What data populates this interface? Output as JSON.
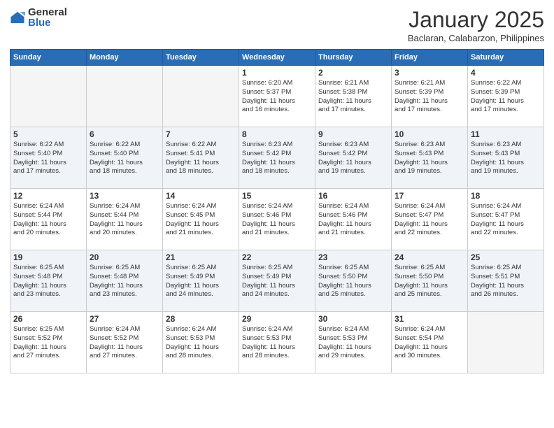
{
  "logo": {
    "general": "General",
    "blue": "Blue"
  },
  "title": "January 2025",
  "location": "Baclaran, Calabarzon, Philippines",
  "days_header": [
    "Sunday",
    "Monday",
    "Tuesday",
    "Wednesday",
    "Thursday",
    "Friday",
    "Saturday"
  ],
  "weeks": [
    [
      {
        "day": "",
        "info": ""
      },
      {
        "day": "",
        "info": ""
      },
      {
        "day": "",
        "info": ""
      },
      {
        "day": "1",
        "info": "Sunrise: 6:20 AM\nSunset: 5:37 PM\nDaylight: 11 hours\nand 16 minutes."
      },
      {
        "day": "2",
        "info": "Sunrise: 6:21 AM\nSunset: 5:38 PM\nDaylight: 11 hours\nand 17 minutes."
      },
      {
        "day": "3",
        "info": "Sunrise: 6:21 AM\nSunset: 5:39 PM\nDaylight: 11 hours\nand 17 minutes."
      },
      {
        "day": "4",
        "info": "Sunrise: 6:22 AM\nSunset: 5:39 PM\nDaylight: 11 hours\nand 17 minutes."
      }
    ],
    [
      {
        "day": "5",
        "info": "Sunrise: 6:22 AM\nSunset: 5:40 PM\nDaylight: 11 hours\nand 17 minutes."
      },
      {
        "day": "6",
        "info": "Sunrise: 6:22 AM\nSunset: 5:40 PM\nDaylight: 11 hours\nand 18 minutes."
      },
      {
        "day": "7",
        "info": "Sunrise: 6:22 AM\nSunset: 5:41 PM\nDaylight: 11 hours\nand 18 minutes."
      },
      {
        "day": "8",
        "info": "Sunrise: 6:23 AM\nSunset: 5:42 PM\nDaylight: 11 hours\nand 18 minutes."
      },
      {
        "day": "9",
        "info": "Sunrise: 6:23 AM\nSunset: 5:42 PM\nDaylight: 11 hours\nand 19 minutes."
      },
      {
        "day": "10",
        "info": "Sunrise: 6:23 AM\nSunset: 5:43 PM\nDaylight: 11 hours\nand 19 minutes."
      },
      {
        "day": "11",
        "info": "Sunrise: 6:23 AM\nSunset: 5:43 PM\nDaylight: 11 hours\nand 19 minutes."
      }
    ],
    [
      {
        "day": "12",
        "info": "Sunrise: 6:24 AM\nSunset: 5:44 PM\nDaylight: 11 hours\nand 20 minutes."
      },
      {
        "day": "13",
        "info": "Sunrise: 6:24 AM\nSunset: 5:44 PM\nDaylight: 11 hours\nand 20 minutes."
      },
      {
        "day": "14",
        "info": "Sunrise: 6:24 AM\nSunset: 5:45 PM\nDaylight: 11 hours\nand 21 minutes."
      },
      {
        "day": "15",
        "info": "Sunrise: 6:24 AM\nSunset: 5:46 PM\nDaylight: 11 hours\nand 21 minutes."
      },
      {
        "day": "16",
        "info": "Sunrise: 6:24 AM\nSunset: 5:46 PM\nDaylight: 11 hours\nand 21 minutes."
      },
      {
        "day": "17",
        "info": "Sunrise: 6:24 AM\nSunset: 5:47 PM\nDaylight: 11 hours\nand 22 minutes."
      },
      {
        "day": "18",
        "info": "Sunrise: 6:24 AM\nSunset: 5:47 PM\nDaylight: 11 hours\nand 22 minutes."
      }
    ],
    [
      {
        "day": "19",
        "info": "Sunrise: 6:25 AM\nSunset: 5:48 PM\nDaylight: 11 hours\nand 23 minutes."
      },
      {
        "day": "20",
        "info": "Sunrise: 6:25 AM\nSunset: 5:48 PM\nDaylight: 11 hours\nand 23 minutes."
      },
      {
        "day": "21",
        "info": "Sunrise: 6:25 AM\nSunset: 5:49 PM\nDaylight: 11 hours\nand 24 minutes."
      },
      {
        "day": "22",
        "info": "Sunrise: 6:25 AM\nSunset: 5:49 PM\nDaylight: 11 hours\nand 24 minutes."
      },
      {
        "day": "23",
        "info": "Sunrise: 6:25 AM\nSunset: 5:50 PM\nDaylight: 11 hours\nand 25 minutes."
      },
      {
        "day": "24",
        "info": "Sunrise: 6:25 AM\nSunset: 5:50 PM\nDaylight: 11 hours\nand 25 minutes."
      },
      {
        "day": "25",
        "info": "Sunrise: 6:25 AM\nSunset: 5:51 PM\nDaylight: 11 hours\nand 26 minutes."
      }
    ],
    [
      {
        "day": "26",
        "info": "Sunrise: 6:25 AM\nSunset: 5:52 PM\nDaylight: 11 hours\nand 27 minutes."
      },
      {
        "day": "27",
        "info": "Sunrise: 6:24 AM\nSunset: 5:52 PM\nDaylight: 11 hours\nand 27 minutes."
      },
      {
        "day": "28",
        "info": "Sunrise: 6:24 AM\nSunset: 5:53 PM\nDaylight: 11 hours\nand 28 minutes."
      },
      {
        "day": "29",
        "info": "Sunrise: 6:24 AM\nSunset: 5:53 PM\nDaylight: 11 hours\nand 28 minutes."
      },
      {
        "day": "30",
        "info": "Sunrise: 6:24 AM\nSunset: 5:53 PM\nDaylight: 11 hours\nand 29 minutes."
      },
      {
        "day": "31",
        "info": "Sunrise: 6:24 AM\nSunset: 5:54 PM\nDaylight: 11 hours\nand 30 minutes."
      },
      {
        "day": "",
        "info": ""
      }
    ]
  ]
}
